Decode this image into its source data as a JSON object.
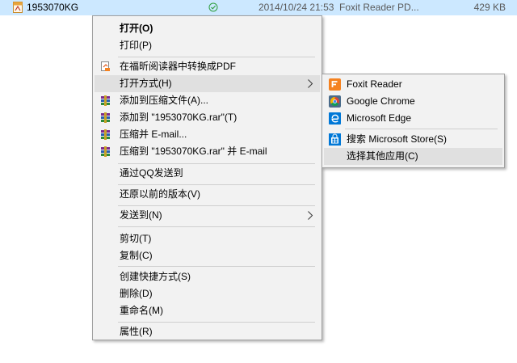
{
  "file": {
    "name": "1953070KG",
    "date": "2014/10/24 21:53",
    "type": "Foxit Reader PD...",
    "size": "429 KB"
  },
  "menu": {
    "open": "打开(O)",
    "print": "打印(P)",
    "convert_pdf": "在福昕阅读器中转换成PDF",
    "open_with": "打开方式(H)",
    "add_archive": "添加到压缩文件(A)...",
    "add_to_rar": "添加到 \"1953070KG.rar\"(T)",
    "compress_email": "压缩并 E-mail...",
    "compress_rar_email": "压缩到 \"1953070KG.rar\" 并 E-mail",
    "send_qq": "通过QQ发送到",
    "restore_versions": "还原以前的版本(V)",
    "send_to": "发送到(N)",
    "cut": "剪切(T)",
    "copy": "复制(C)",
    "create_shortcut": "创建快捷方式(S)",
    "delete": "删除(D)",
    "rename": "重命名(M)",
    "properties": "属性(R)"
  },
  "submenu": {
    "foxit": "Foxit Reader",
    "chrome": "Google Chrome",
    "edge": "Microsoft Edge",
    "store": "搜索 Microsoft Store(S)",
    "other": "选择其他应用(C)"
  },
  "colors": {
    "selection": "#cce8ff",
    "menu_bg": "#f2f2f2",
    "highlight": "#e0e0e0",
    "foxit": "#f58220",
    "edge": "#0078d7"
  }
}
